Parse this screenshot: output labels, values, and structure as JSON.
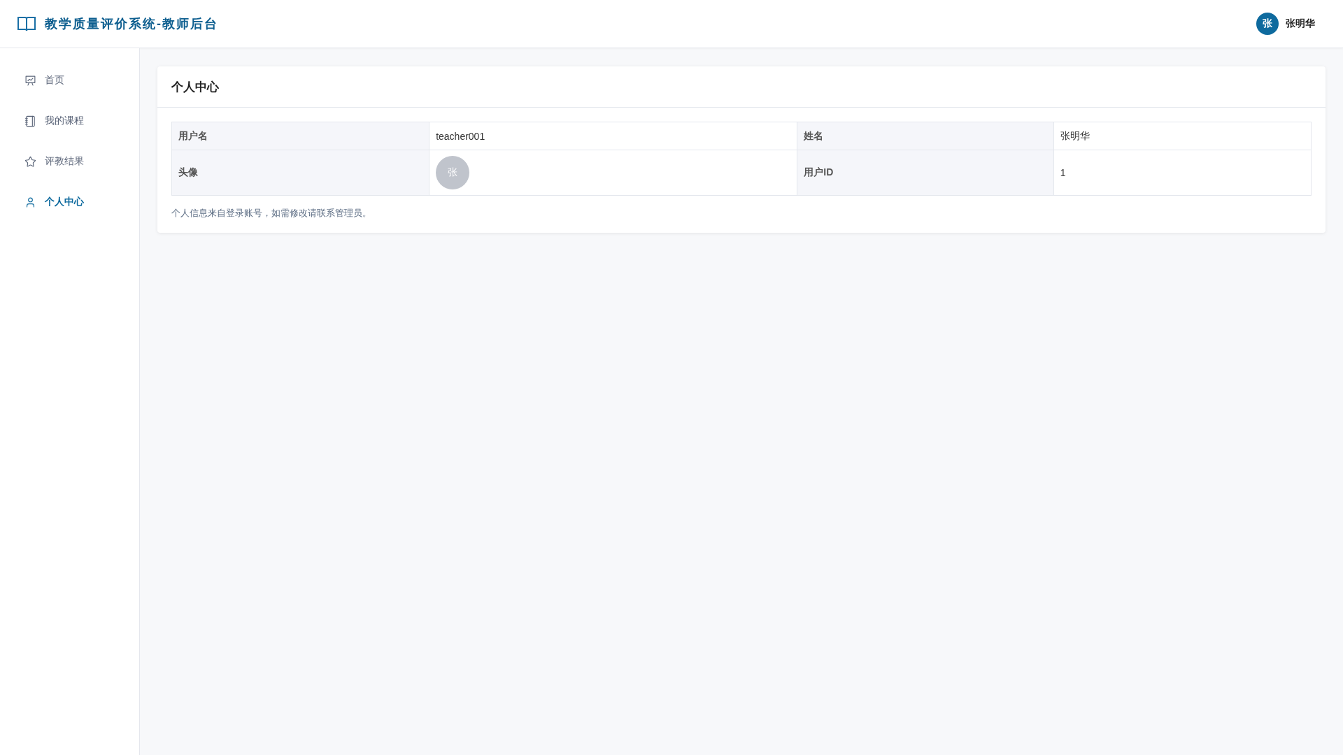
{
  "header": {
    "title": "教学质量评价系统-教师后台",
    "user": {
      "avatar": "张",
      "name": "张明华"
    }
  },
  "sidebar": {
    "items": [
      {
        "label": "首页",
        "selected": false
      },
      {
        "label": "我的课程",
        "selected": false
      },
      {
        "label": "评教结果",
        "selected": false
      },
      {
        "label": "个人中心",
        "selected": true
      }
    ]
  },
  "page": {
    "title": "个人中心",
    "table": {
      "rows": [
        [
          {
            "kind": "label",
            "text": "用户名"
          },
          {
            "kind": "value",
            "text": "teacher001"
          },
          {
            "kind": "label",
            "text": "姓名"
          },
          {
            "kind": "value",
            "text": "张明华"
          }
        ],
        [
          {
            "kind": "label",
            "text": "头像"
          },
          {
            "kind": "avatar",
            "text": "张"
          },
          {
            "kind": "label",
            "text": "用户ID"
          },
          {
            "kind": "value",
            "text": "1"
          }
        ]
      ]
    },
    "note": "个人信息来自登录账号，如需修改请联系管理员。"
  }
}
